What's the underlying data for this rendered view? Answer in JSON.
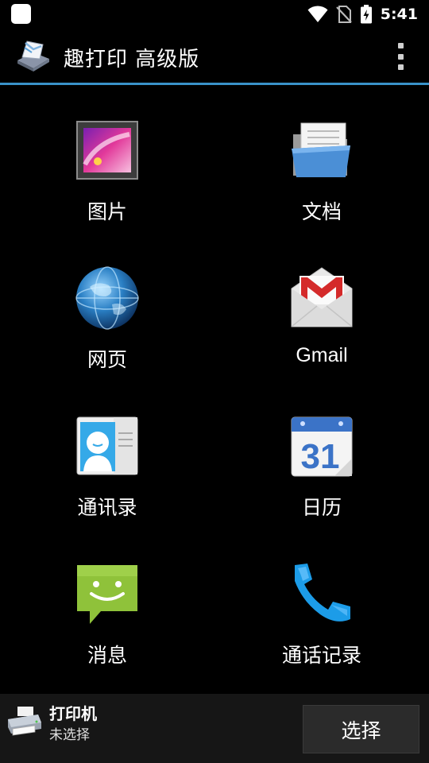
{
  "status_bar": {
    "time": "5:41",
    "icons": [
      "wifi-icon",
      "no-sim-icon",
      "battery-charging-icon"
    ]
  },
  "action_bar": {
    "title": "趣打印 高级版",
    "logo_icon": "printer-paper-logo-icon",
    "menu_icon": "overflow-menu-icon"
  },
  "grid": {
    "items": [
      {
        "label": "图片",
        "icon": "picture-frame-icon"
      },
      {
        "label": "文档",
        "icon": "document-folder-icon"
      },
      {
        "label": "网页",
        "icon": "globe-icon"
      },
      {
        "label": "Gmail",
        "icon": "gmail-envelope-icon"
      },
      {
        "label": "通讯录",
        "icon": "contacts-card-icon"
      },
      {
        "label": "日历",
        "icon": "calendar-icon",
        "calendar_day": "31"
      },
      {
        "label": "消息",
        "icon": "message-bubble-icon"
      },
      {
        "label": "通话记录",
        "icon": "phone-handset-icon"
      }
    ]
  },
  "bottom_bar": {
    "printer_title": "打印机",
    "printer_status": "未选择",
    "select_label": "选择"
  },
  "colors": {
    "accent": "#3a92c9",
    "background": "#000000",
    "bottom_bar": "#161616"
  }
}
